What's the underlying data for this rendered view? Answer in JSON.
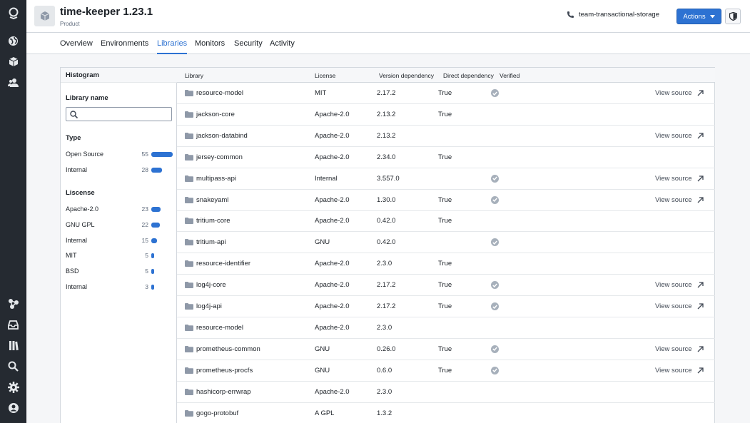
{
  "rail": {
    "top_icons": [
      "logo-icon",
      "globe-icon",
      "cube-icon",
      "people-icon"
    ],
    "bottom_icons": [
      "graph-icon",
      "inbox-icon",
      "library-icon",
      "search-icon",
      "gear-icon",
      "user-icon"
    ]
  },
  "header": {
    "title": "time-keeper 1.23.1",
    "subtitle": "Product",
    "contact": "team-transactional-storage",
    "actions_label": "Actions"
  },
  "tabs": [
    {
      "label": "Overview",
      "active": false
    },
    {
      "label": "Environments",
      "active": false
    },
    {
      "label": "Libraries",
      "active": true
    },
    {
      "label": "Monitors",
      "active": false
    },
    {
      "label": "Security",
      "active": false
    },
    {
      "label": "Activity",
      "active": false
    }
  ],
  "filters": {
    "title": "Histogram",
    "library_name_label": "Library name",
    "search_value": "",
    "type_label": "Type",
    "types": [
      {
        "name": "Open Source",
        "count": 55
      },
      {
        "name": "Internal",
        "count": 28
      }
    ],
    "license_label": "Liscense",
    "licenses": [
      {
        "name": "Apache-2.0",
        "count": 23
      },
      {
        "name": "GNU GPL",
        "count": 22
      },
      {
        "name": "Internal",
        "count": 15
      },
      {
        "name": "MIT",
        "count": 5
      },
      {
        "name": "BSD",
        "count": 5
      },
      {
        "name": "Internal",
        "count": 3
      }
    ]
  },
  "table": {
    "columns": [
      "Library",
      "License",
      "Version dependency",
      "Direct dependency",
      "Verified"
    ],
    "view_source_label": "View source",
    "rows": [
      {
        "library": "resource-model",
        "license": "MIT",
        "version": "2.17.2",
        "direct": "True",
        "verified": true,
        "view_source": true
      },
      {
        "library": "jackson-core",
        "license": "Apache-2.0",
        "version": "2.13.2",
        "direct": "True",
        "verified": false,
        "view_source": false
      },
      {
        "library": "jackson-databind",
        "license": "Apache-2.0",
        "version": "2.13.2",
        "direct": "",
        "verified": false,
        "view_source": true
      },
      {
        "library": "jersey-common",
        "license": "Apache-2.0",
        "version": "2.34.0",
        "direct": "True",
        "verified": false,
        "view_source": false
      },
      {
        "library": "multipass-api",
        "license": "Internal",
        "version": "3.557.0",
        "direct": "",
        "verified": true,
        "view_source": true
      },
      {
        "library": "snakeyaml",
        "license": "Apache-2.0",
        "version": "1.30.0",
        "direct": "True",
        "verified": true,
        "view_source": true
      },
      {
        "library": "tritium-core",
        "license": "Apache-2.0",
        "version": "0.42.0",
        "direct": "True",
        "verified": false,
        "view_source": false
      },
      {
        "library": "tritium-api",
        "license": "GNU",
        "version": "0.42.0",
        "direct": "",
        "verified": true,
        "view_source": false
      },
      {
        "library": "resource-identifier",
        "license": "Apache-2.0",
        "version": "2.3.0",
        "direct": "True",
        "verified": false,
        "view_source": false
      },
      {
        "library": "log4j-core",
        "license": "Apache-2.0",
        "version": "2.17.2",
        "direct": "True",
        "verified": true,
        "view_source": true
      },
      {
        "library": "log4j-api",
        "license": "Apache-2.0",
        "version": "2.17.2",
        "direct": "True",
        "verified": true,
        "view_source": true
      },
      {
        "library": "resource-model",
        "license": "Apache-2.0",
        "version": "2.3.0",
        "direct": "",
        "verified": false,
        "view_source": false
      },
      {
        "library": "prometheus-common",
        "license": "GNU",
        "version": "0.26.0",
        "direct": "True",
        "verified": true,
        "view_source": true
      },
      {
        "library": "prometheus-procfs",
        "license": "GNU",
        "version": "0.6.0",
        "direct": "True",
        "verified": true,
        "view_source": true
      },
      {
        "library": "hashicorp-errwrap",
        "license": "Apache-2.0",
        "version": "2.3.0",
        "direct": "",
        "verified": false,
        "view_source": false
      },
      {
        "library": "gogo-protobuf",
        "license": "A GPL",
        "version": "1.3.2",
        "direct": "",
        "verified": false,
        "view_source": false
      }
    ]
  },
  "colors": {
    "accent": "#2d72d2",
    "rail": "#252a31",
    "verified": "#a7b0bb"
  }
}
